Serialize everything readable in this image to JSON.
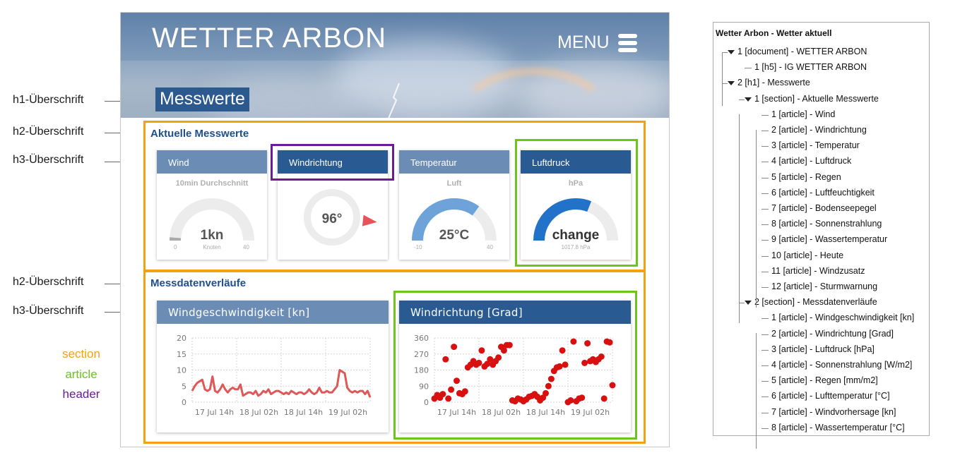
{
  "annotations": {
    "h1_label": "h1-Überschrift",
    "h2_label_1": "h2-Überschrift",
    "h3_label_1": "h3-Überschrift",
    "h2_label_2": "h2-Überschrift",
    "h3_label_2": "h3-Überschrift",
    "legend": [
      {
        "label": "section",
        "color": "#f5a00f"
      },
      {
        "label": "article",
        "color": "#6cc51c"
      },
      {
        "label": "header",
        "color": "#6a1b9a"
      }
    ]
  },
  "site": {
    "title": "WETTER ARBON",
    "menu_label": "MENU",
    "menu_icon": "hamburger-icon",
    "h1": "Messwerte"
  },
  "section_current": {
    "heading": "Aktuelle Messwerte",
    "cards": [
      {
        "title": "Wind",
        "subtitle": "10min Durchschnitt",
        "value": "1kn",
        "unit": "Knoten",
        "min": "0",
        "max": "40",
        "fill_fraction": 0.025,
        "fill_color": "#aaaaaa"
      },
      {
        "title": "Windrichtung",
        "value": "96°",
        "direction_deg": 96,
        "pointer_color": "#e8535a"
      },
      {
        "title": "Temperatur",
        "subtitle": "Luft",
        "value": "25°C",
        "min": "-10",
        "max": "40",
        "fill_fraction": 0.7,
        "fill_color": "#6da3d9"
      },
      {
        "title": "Luftdruck",
        "subtitle": "hPa",
        "value": "change",
        "unit": "1017.8 hPa",
        "fill_fraction": 0.62,
        "fill_color": "#2272c9"
      }
    ]
  },
  "section_history": {
    "heading": "Messdatenverläufe",
    "charts": [
      {
        "title": "Windgeschwindigkeit [kn]"
      },
      {
        "title": "Windrichtung [Grad]"
      }
    ]
  },
  "chart_data": [
    {
      "type": "line",
      "title": "Windgeschwindigkeit [kn]",
      "xlabel": "",
      "ylabel": "",
      "ylim": [
        0,
        20
      ],
      "yticks": [
        "20",
        "15",
        "10",
        "5",
        "0"
      ],
      "xticks": [
        "17 Jul 14h",
        "18 Jul 02h",
        "18 Jul 14h",
        "19 Jul 02h"
      ],
      "grid": true,
      "color": "#e05757",
      "x": [
        0,
        1,
        2,
        3,
        4,
        5,
        6,
        7,
        8,
        9,
        10,
        11,
        12,
        13,
        14,
        15,
        16,
        17,
        18,
        19,
        20,
        21,
        22,
        23,
        24,
        25,
        26,
        27,
        28,
        29,
        30,
        31,
        32,
        33,
        34,
        35,
        36,
        37,
        38,
        39,
        40,
        41,
        42,
        43,
        44,
        45,
        46,
        47,
        48,
        49,
        50,
        51,
        52,
        53,
        54,
        55,
        56,
        57,
        58,
        59,
        60,
        61,
        62,
        63,
        64,
        65,
        66,
        67,
        68,
        69,
        70
      ],
      "values": [
        3.5,
        5,
        6,
        6.5,
        7,
        4,
        3.5,
        4,
        8,
        3.5,
        3,
        4,
        5.5,
        4,
        3,
        4,
        4.5,
        4,
        4,
        5.5,
        2,
        2.5,
        3,
        3,
        2.5,
        3.5,
        2,
        2.5,
        3.5,
        3,
        4,
        2.5,
        3,
        3.5,
        3.5,
        3,
        2.5,
        3,
        2.5,
        3.5,
        3,
        2.5,
        3,
        3,
        2.5,
        3,
        4,
        3,
        2.5,
        3,
        4.5,
        3,
        3,
        3.5,
        3,
        3,
        4,
        5,
        10,
        9.5,
        9,
        4.5,
        3.5,
        3,
        3.5,
        3,
        3.5,
        3.5,
        2.5,
        3.5,
        1.5
      ]
    },
    {
      "type": "scatter",
      "title": "Windrichtung [Grad]",
      "xlabel": "",
      "ylabel": "",
      "ylim": [
        0,
        360
      ],
      "yticks": [
        "360",
        "270",
        "180",
        "90",
        "0"
      ],
      "xticks": [
        "17 Jul 14h",
        "18 Jul 02h",
        "18 Jul 14h",
        "19 Jul 02h"
      ],
      "grid": true,
      "color": "#d81010",
      "points": [
        [
          0,
          20
        ],
        [
          1,
          40
        ],
        [
          2,
          25
        ],
        [
          3,
          45
        ],
        [
          4,
          240
        ],
        [
          5,
          20
        ],
        [
          6,
          70
        ],
        [
          7,
          310
        ],
        [
          8,
          120
        ],
        [
          9,
          50
        ],
        [
          10,
          45
        ],
        [
          11,
          60
        ],
        [
          12,
          195
        ],
        [
          13,
          210
        ],
        [
          14,
          230
        ],
        [
          15,
          210
        ],
        [
          16,
          220
        ],
        [
          17,
          290
        ],
        [
          18,
          200
        ],
        [
          19,
          215
        ],
        [
          20,
          240
        ],
        [
          21,
          210
        ],
        [
          22,
          230
        ],
        [
          23,
          250
        ],
        [
          24,
          310
        ],
        [
          25,
          290
        ],
        [
          26,
          320
        ],
        [
          27,
          320
        ],
        [
          28,
          10
        ],
        [
          29,
          5
        ],
        [
          30,
          20
        ],
        [
          31,
          15
        ],
        [
          32,
          5
        ],
        [
          33,
          15
        ],
        [
          34,
          30
        ],
        [
          35,
          35
        ],
        [
          36,
          45
        ],
        [
          37,
          30
        ],
        [
          38,
          10
        ],
        [
          39,
          25
        ],
        [
          40,
          50
        ],
        [
          41,
          90
        ],
        [
          42,
          130
        ],
        [
          43,
          175
        ],
        [
          44,
          195
        ],
        [
          45,
          200
        ],
        [
          46,
          290
        ],
        [
          47,
          210
        ],
        [
          48,
          0
        ],
        [
          49,
          10
        ],
        [
          50,
          340
        ],
        [
          51,
          5
        ],
        [
          52,
          20
        ],
        [
          53,
          25
        ],
        [
          54,
          220
        ],
        [
          55,
          330
        ],
        [
          56,
          230
        ],
        [
          57,
          240
        ],
        [
          58,
          225
        ],
        [
          59,
          240
        ],
        [
          60,
          255
        ],
        [
          61,
          20
        ],
        [
          62,
          340
        ],
        [
          63,
          335
        ],
        [
          64,
          95
        ]
      ]
    }
  ],
  "outline": {
    "title": "Wetter Arbon - Wetter aktuell",
    "items": [
      {
        "text": "1 [document] - WETTER ARBON"
      },
      {
        "text": "1 [h5] - IG WETTER ARBON"
      },
      {
        "text": "2 [h1] - Messwerte"
      },
      {
        "text": "1 [section] - Aktuelle Messwerte"
      },
      {
        "text": "1 [article] - Wind"
      },
      {
        "text": "2 [article] - Windrichtung"
      },
      {
        "text": "3 [article] - Temperatur"
      },
      {
        "text": "4 [article] - Luftdruck"
      },
      {
        "text": "5 [article] - Regen"
      },
      {
        "text": "6 [article] - Luftfeuchtigkeit"
      },
      {
        "text": "7 [article] - Bodenseepegel"
      },
      {
        "text": "8 [article] - Sonnenstrahlung"
      },
      {
        "text": "9 [article] - Wassertemperatur"
      },
      {
        "text": "10 [article] - Heute"
      },
      {
        "text": "11 [article] - Windzusatz"
      },
      {
        "text": "12 [article] - Sturmwarnung"
      },
      {
        "text": "2 [section] - Messdatenverläufe"
      },
      {
        "text": "1 [article] - Windgeschwindigkeit [kn]"
      },
      {
        "text": "2 [article] - Windrichtung [Grad]"
      },
      {
        "text": "3 [article] - Luftdruck [hPa]"
      },
      {
        "text": "4 [article] - Sonnenstrahlung [W/m2]"
      },
      {
        "text": "5 [article] - Regen [mm/m2]"
      },
      {
        "text": "6 [article] - Lufttemperatur [°C]"
      },
      {
        "text": "7 [article] - Windvorhersage [kn]"
      },
      {
        "text": "8 [article] - Wassertemperatur [°C]"
      }
    ]
  }
}
